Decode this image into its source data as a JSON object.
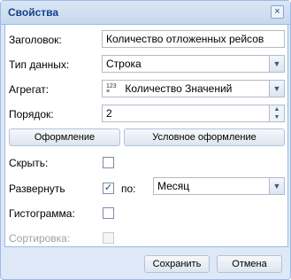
{
  "window": {
    "title": "Свойства",
    "close_glyph": "×"
  },
  "form": {
    "title_label": "Заголовок:",
    "title_value": "Количество отложенных рейсов",
    "datatype_label": "Тип данных:",
    "datatype_value": "Строка",
    "aggregate_label": "Агрегат:",
    "aggregate_icon_text": "123",
    "aggregate_value": "Количество Значений",
    "order_label": "Порядок:",
    "order_value": "2",
    "format_button": "Оформление",
    "conditional_button": "Условное оформление",
    "hide_label": "Скрыть:",
    "expand_label": "Развернуть",
    "by_label": "по:",
    "by_value": "Месяц",
    "histogram_label": "Гистограмма:",
    "sort_label": "Сортировка:",
    "checkmark": "✓"
  },
  "footer": {
    "save_label": "Сохранить",
    "cancel_label": "Отмена"
  },
  "icons": {
    "dropdown": "chevron-down-icon",
    "spinner_up": "spinner-up-icon",
    "spinner_down": "spinner-down-icon",
    "aggregate": "count-values-icon"
  },
  "colors": {
    "title": "#15428b",
    "border": "#99bbe8",
    "panel": "#dfe8f6"
  }
}
